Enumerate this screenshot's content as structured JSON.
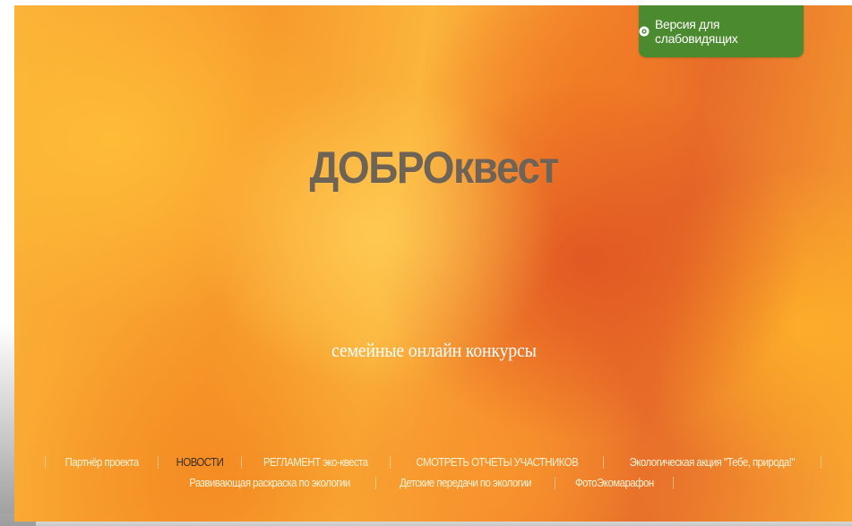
{
  "header": {
    "accessibility_label": "Версия для слабовидящих",
    "accessibility_icon": "eye-icon"
  },
  "hero": {
    "title": "ДОБРОквест",
    "subtitle": "семейные онлайн конкурсы"
  },
  "nav": {
    "row1": [
      {
        "label": "Партнёр проекта",
        "active": false
      },
      {
        "label": "НОВОСТИ",
        "active": true
      },
      {
        "label": "РЕГЛАМЕНТ эко-квеста",
        "active": false
      },
      {
        "label": "СМОТРЕТЬ ОТЧЕТЫ УЧАСТНИКОВ",
        "active": false
      },
      {
        "label": "Экологическая акция \"Тебе, природа!\"",
        "active": false
      }
    ],
    "row2": [
      {
        "label": "Развивающая раскраска по экологии",
        "active": false
      },
      {
        "label": "Детские передачи по экологии",
        "active": false
      },
      {
        "label": "ФотоЭкомарафон",
        "active": false
      }
    ]
  },
  "colors": {
    "accessibility_button": "#4c8a2f",
    "title_text": "#6f6355",
    "active_nav": "#3d2f22"
  }
}
